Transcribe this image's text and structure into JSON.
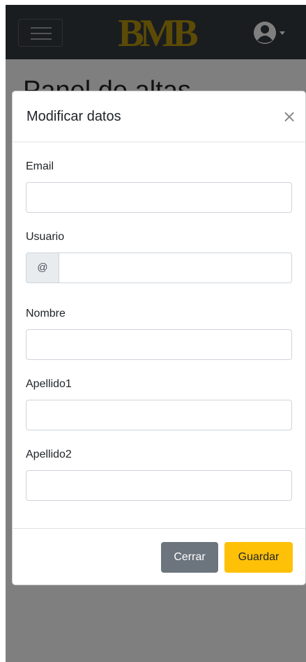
{
  "navbar": {
    "logo_text": "BMB",
    "colors": {
      "background": "#343a40",
      "logo": "#b8960c",
      "avatar": "#ffffff"
    },
    "icons": {
      "menu": "hamburger-icon",
      "user": "user-circle-icon",
      "dropdown": "caret-down-icon"
    }
  },
  "page": {
    "heading": "Panel de altas"
  },
  "modal": {
    "title": "Modificar datos",
    "close_symbol": "×",
    "fields": {
      "email": {
        "label": "Email",
        "value": ""
      },
      "usuario": {
        "label": "Usuario",
        "prefix": "@",
        "value": ""
      },
      "nombre": {
        "label": "Nombre",
        "value": ""
      },
      "apellido1": {
        "label": "Apellido1",
        "value": ""
      },
      "apellido2": {
        "label": "Apellido2",
        "value": ""
      }
    },
    "buttons": {
      "close_label": "Cerrar",
      "save_label": "Guardar"
    },
    "colors": {
      "secondary": "#6c757d",
      "warning": "#ffc107"
    }
  }
}
